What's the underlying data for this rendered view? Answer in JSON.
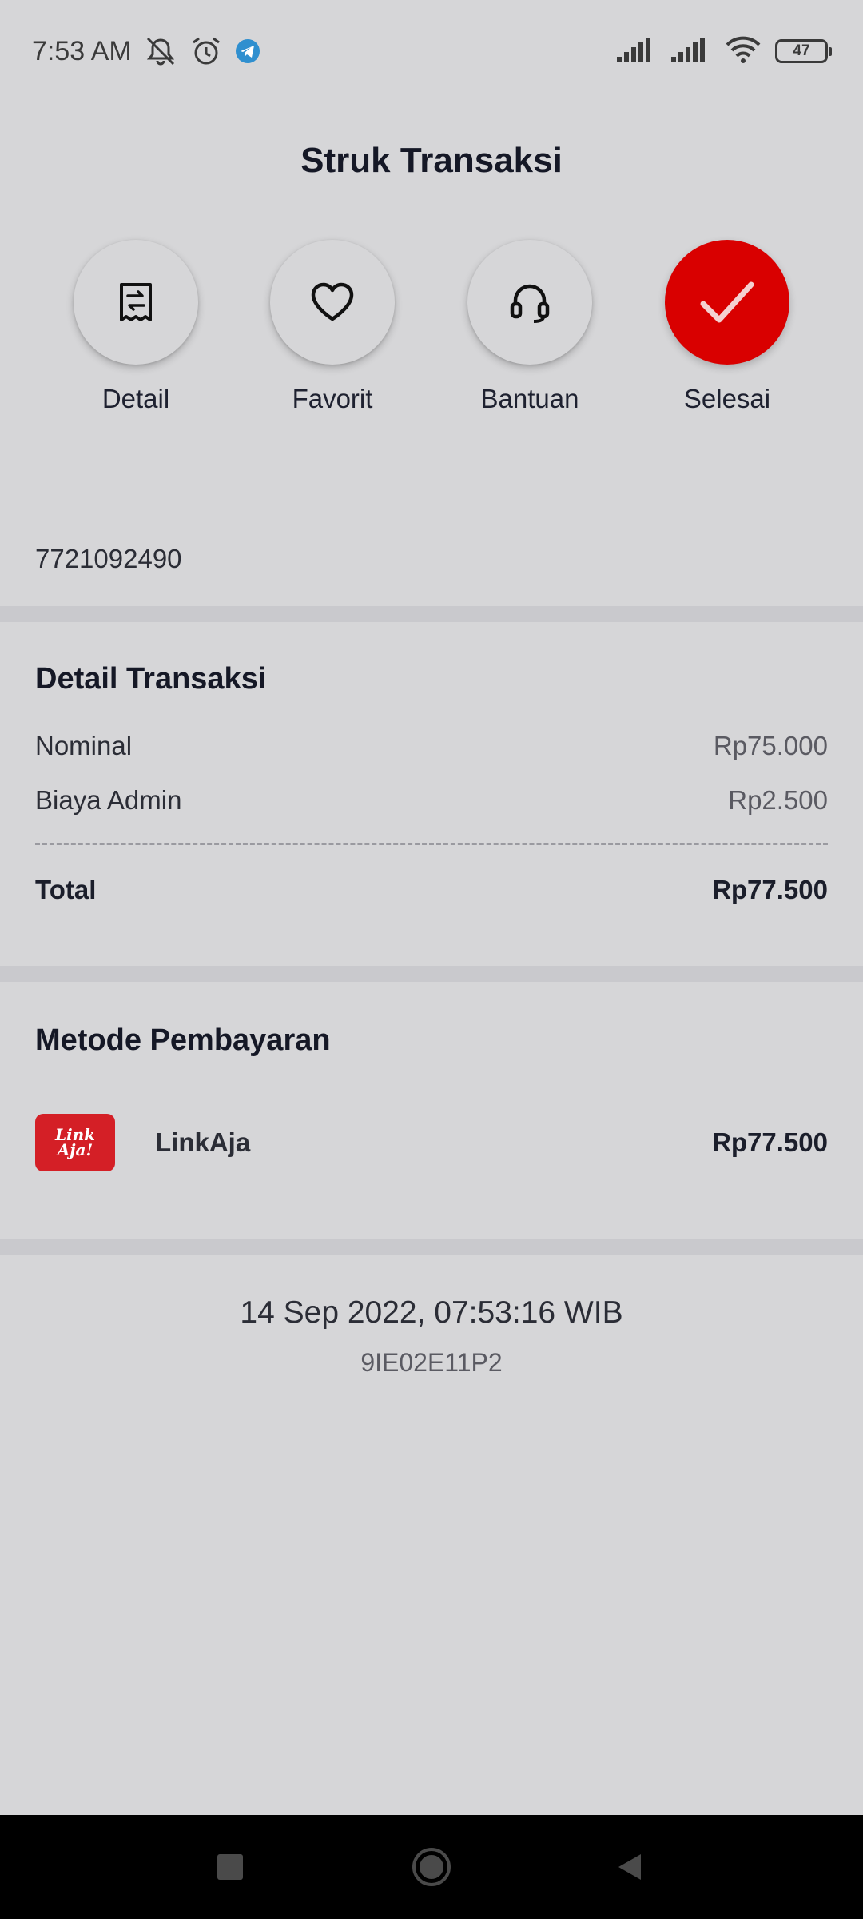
{
  "status_bar": {
    "time": "7:53 AM",
    "battery": "47",
    "icons": [
      "mute-icon",
      "alarm-icon",
      "telegram-icon",
      "signal-icon",
      "signal-icon",
      "wifi-icon",
      "battery-icon"
    ]
  },
  "header": {
    "title": "Struk Transaksi"
  },
  "actions": [
    {
      "label": "Detail",
      "icon": "receipt-icon"
    },
    {
      "label": "Favorit",
      "icon": "heart-icon"
    },
    {
      "label": "Bantuan",
      "icon": "headset-icon"
    },
    {
      "label": "Selesai",
      "icon": "check-icon"
    }
  ],
  "account_number": "7721092490",
  "transaction_detail": {
    "title": "Detail Transaksi",
    "nominal_label": "Nominal",
    "nominal_value": "Rp75.000",
    "admin_label": "Biaya Admin",
    "admin_value": "Rp2.500",
    "total_label": "Total",
    "total_value": "Rp77.500"
  },
  "payment_method": {
    "title": "Metode Pembayaran",
    "logo_line1": "Link",
    "logo_line2": "Aja!",
    "name": "LinkAja",
    "amount": "Rp77.500"
  },
  "footer": {
    "timestamp": "14 Sep 2022, 07:53:16 WIB",
    "reference": "9IE02E11P2"
  },
  "colors": {
    "background": "#d6d6d8",
    "accent": "#d90000",
    "brand_linkaja": "#d41f26"
  }
}
